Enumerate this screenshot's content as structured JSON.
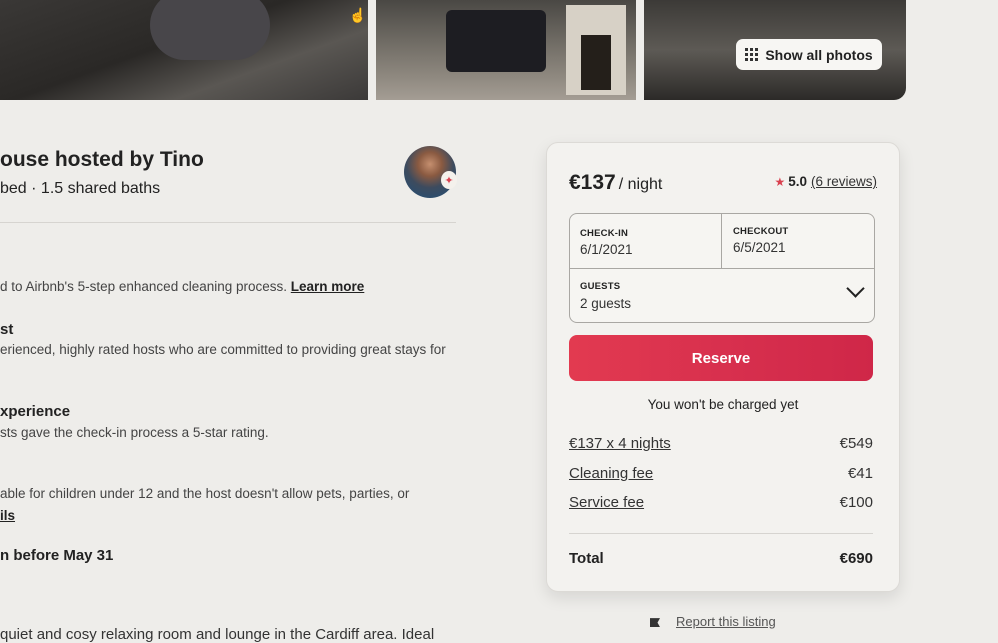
{
  "photos": {
    "show_all_label": "Show all photos"
  },
  "listing": {
    "title": "ouse hosted by Tino",
    "subtitle": "bed · 1.5 shared baths"
  },
  "highlights": {
    "cleaning_text": "d to Airbnb's 5-step enhanced cleaning process.",
    "cleaning_link": "Learn more",
    "superhost_heading": "st",
    "superhost_text": "erienced, highly rated hosts who are committed to providing great stays for",
    "checkin_heading": "xperience",
    "checkin_text": "sts gave the check-in process a 5-star rating.",
    "rules_text": "able for children under 12 and the host doesn't allow pets, parties, or",
    "rules_link": "ils",
    "cancel_heading": "n before May 31",
    "description": "quiet and cosy relaxing room and lounge in the Cardiff area. Ideal"
  },
  "booking": {
    "price": "€137",
    "per_night": "/ night",
    "rating": "5.0",
    "reviews": "(6 reviews)",
    "checkin_label": "CHECK-IN",
    "checkin_value": "6/1/2021",
    "checkout_label": "CHECKOUT",
    "checkout_value": "6/5/2021",
    "guests_label": "GUESTS",
    "guests_value": "2 guests",
    "reserve_label": "Reserve",
    "no_charge_note": "You won't be charged yet",
    "fees": [
      {
        "label": "€137 x 4 nights",
        "value": "€549"
      },
      {
        "label": "Cleaning fee",
        "value": "€41"
      },
      {
        "label": "Service fee",
        "value": "€100"
      }
    ],
    "total_label": "Total",
    "total_value": "€690"
  },
  "report": {
    "label": "Report this listing"
  },
  "colors": {
    "accent": "#d9414f",
    "background": "#eeedea"
  }
}
